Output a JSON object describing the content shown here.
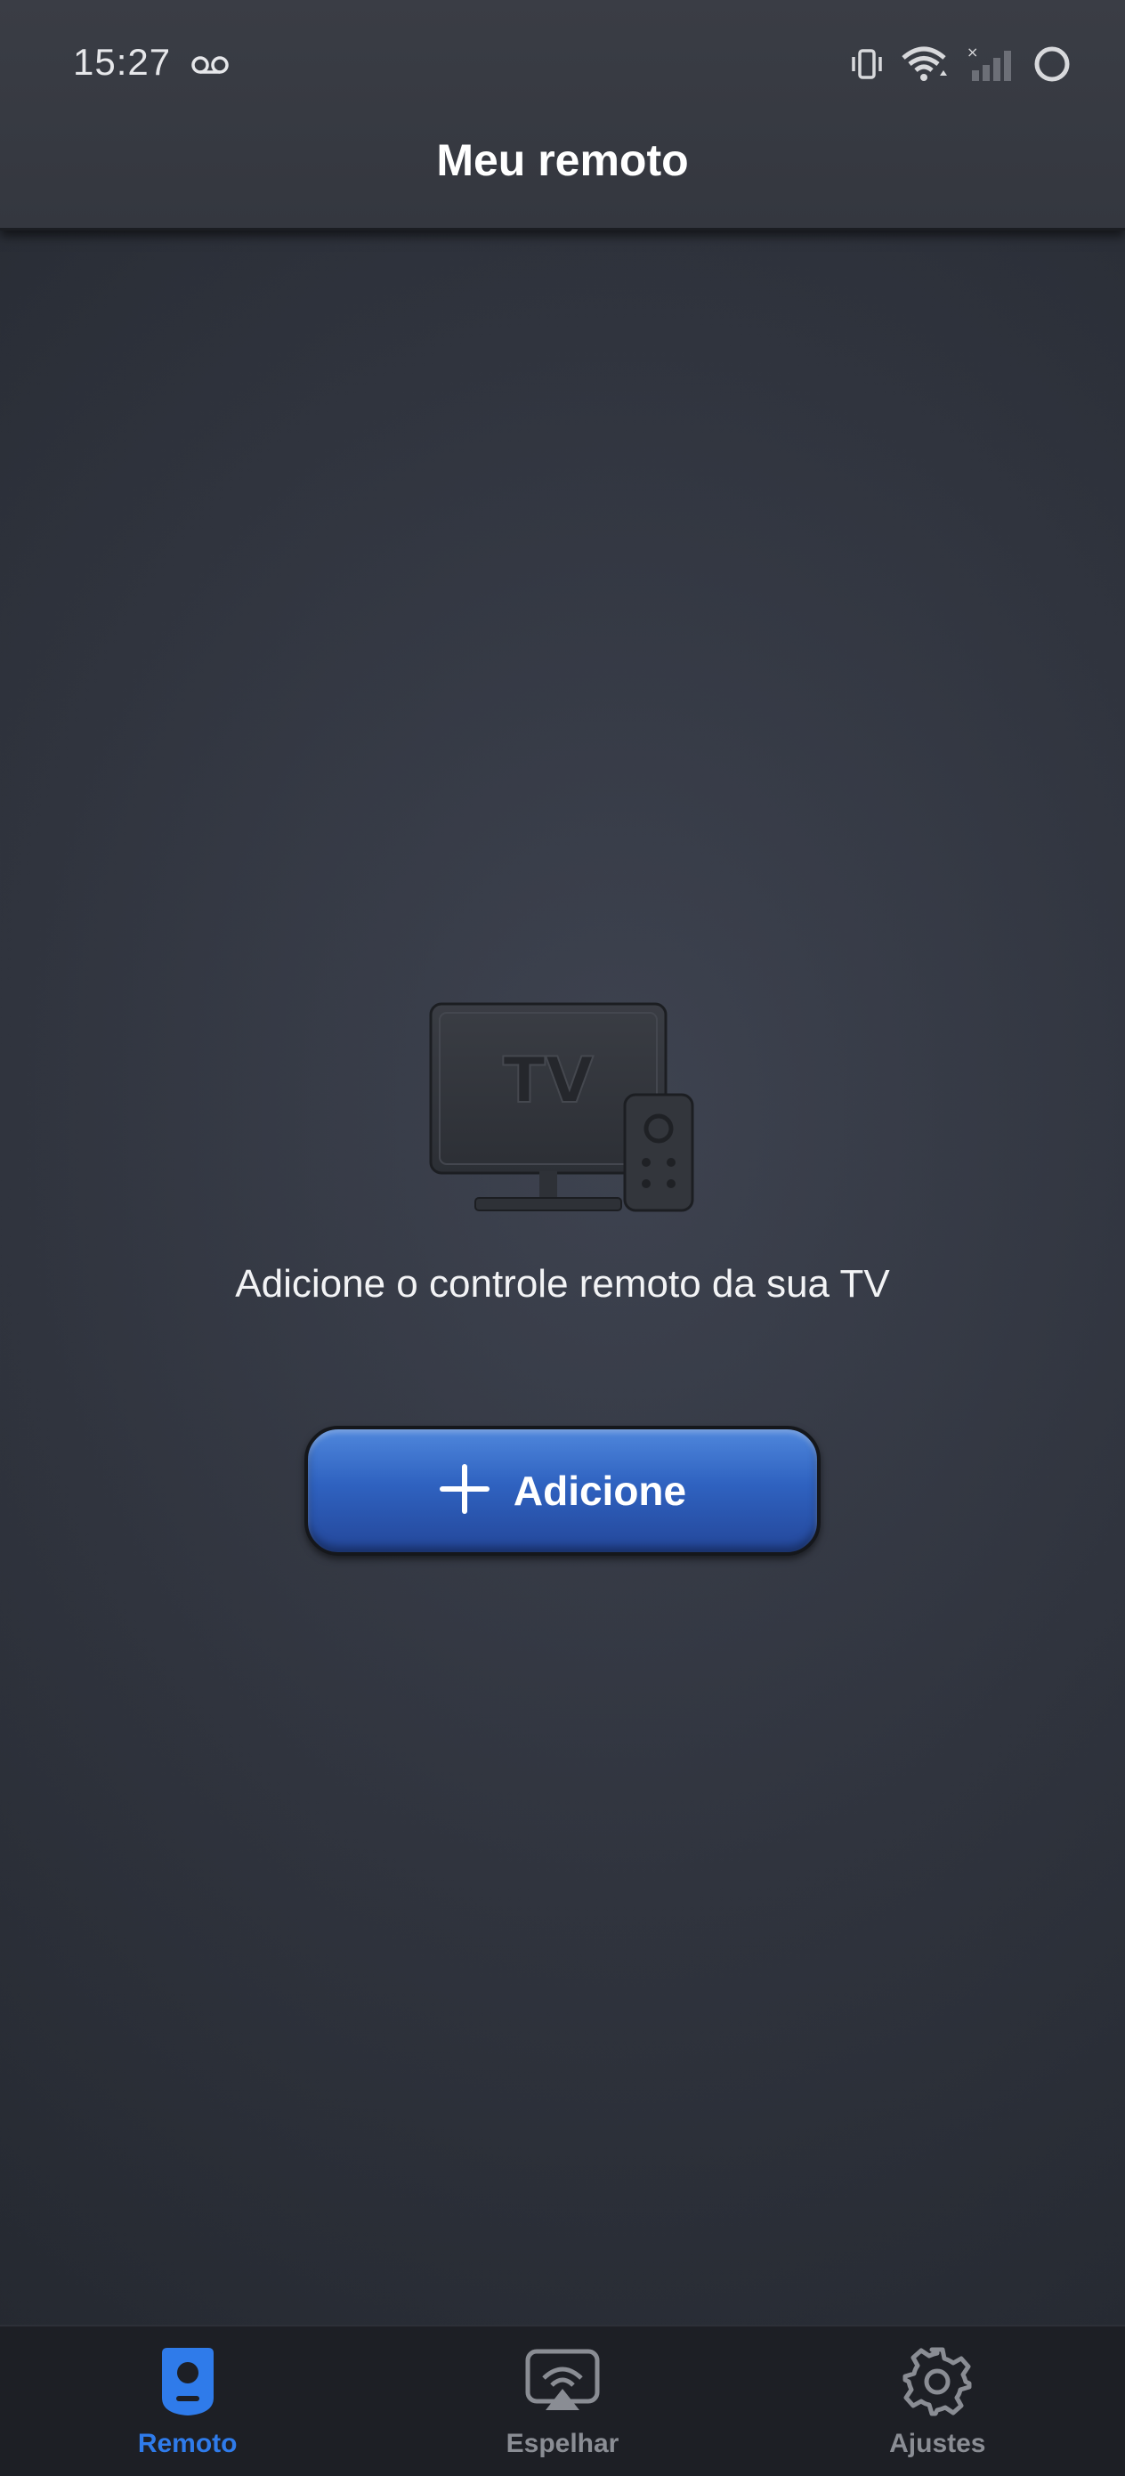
{
  "status_bar": {
    "time": "15:27"
  },
  "app_bar": {
    "title": "Meu remoto"
  },
  "empty_state": {
    "illustration_text": "TV",
    "message": "Adicione o controle remoto da sua TV",
    "add_button_label": "Adicione"
  },
  "bottom_nav": {
    "items": [
      {
        "label": "Remoto",
        "icon": "remote-icon",
        "active": true
      },
      {
        "label": "Espelhar",
        "icon": "screen-mirror-icon",
        "active": false
      },
      {
        "label": "Ajustes",
        "icon": "gear-icon",
        "active": false
      }
    ]
  },
  "colors": {
    "accent": "#2f7bea",
    "button": "#3a6fd0",
    "inactive": "#8a8d94"
  }
}
